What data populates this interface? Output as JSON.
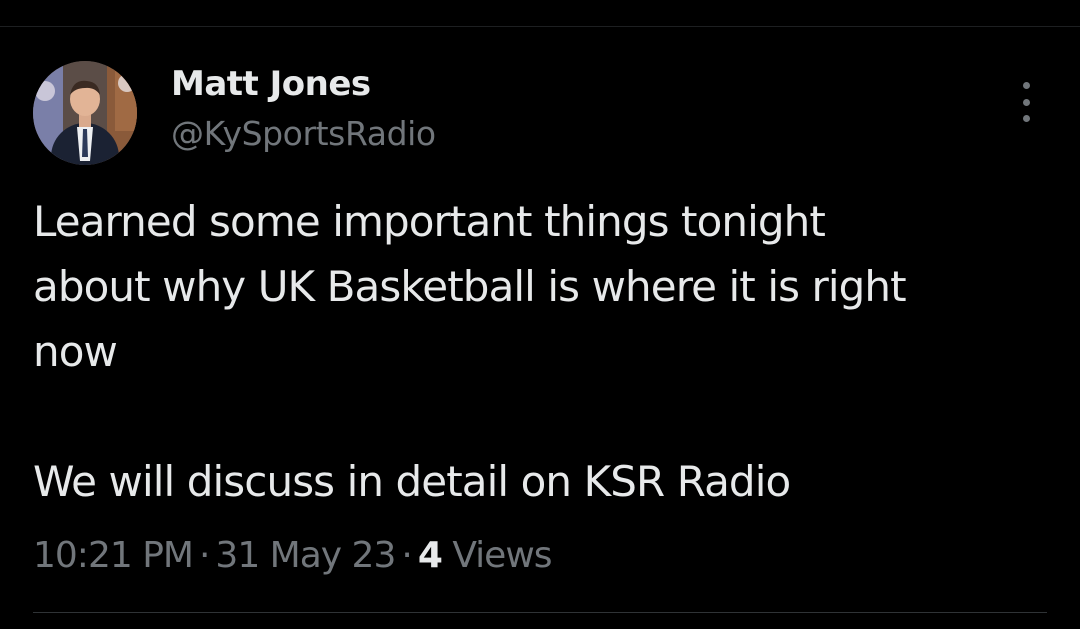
{
  "tweet": {
    "author": {
      "name": "Matt Jones",
      "handle": "@KySportsRadio"
    },
    "text_lines": [
      "Learned some important things tonight",
      "about why UK Basketball is where it is right",
      "now"
    ],
    "text_second_paragraph": "We will discuss in detail on KSR Radio",
    "time": "10:21 PM",
    "date": "31 May 23",
    "separator": "·",
    "views_count": "4",
    "views_label": "Views"
  },
  "icons": {
    "more": "more-vertical-icon"
  },
  "colors": {
    "background": "#000000",
    "primary_text": "#e7e9ea",
    "secondary_text": "#71767b",
    "divider": "#2f3336"
  }
}
